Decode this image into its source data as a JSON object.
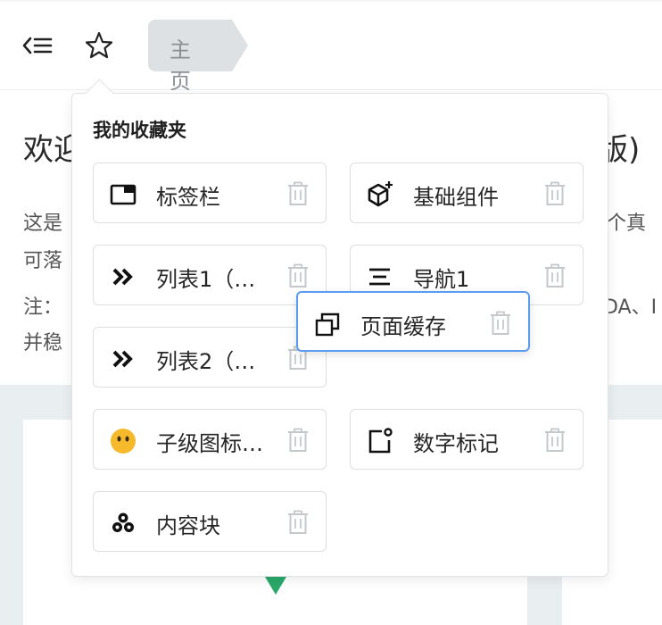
{
  "header": {
    "breadcrumb": "主页",
    "menu_icon": "collapse-menu-icon",
    "star_icon": "star-outline-icon"
  },
  "background": {
    "title_left": "欢迎",
    "title_right": "版)",
    "line1_left": "这是",
    "line1_right": "个真",
    "line2_left": "可落",
    "line3_left": "注：",
    "line3_right": "DA、I",
    "line4_left": "并稳"
  },
  "popup": {
    "title": "我的收藏夹",
    "items": [
      {
        "label": "标签栏",
        "icon": "tabbar-icon"
      },
      {
        "label": "基础组件",
        "icon": "cube-plus-icon"
      },
      {
        "label": "列表1（…",
        "icon": "double-chevron-icon"
      },
      {
        "label": "导航1",
        "icon": "menu-lines-icon"
      },
      {
        "label": "列表2（…",
        "icon": "double-chevron-icon"
      },
      {
        "label": "子级图标…",
        "icon": "smiley-face-icon"
      },
      {
        "label": "数字标记",
        "icon": "badge-square-icon"
      },
      {
        "label": "内容块",
        "icon": "blocks-icon"
      }
    ],
    "dragging_item": {
      "label": "页面缓存",
      "icon": "stacked-windows-icon"
    },
    "delete_icon": "trash-icon"
  },
  "colors": {
    "accent_blue": "#5b9bf0",
    "indicator_green": "#2aa86a",
    "smiley_yellow": "#f6b92b"
  }
}
